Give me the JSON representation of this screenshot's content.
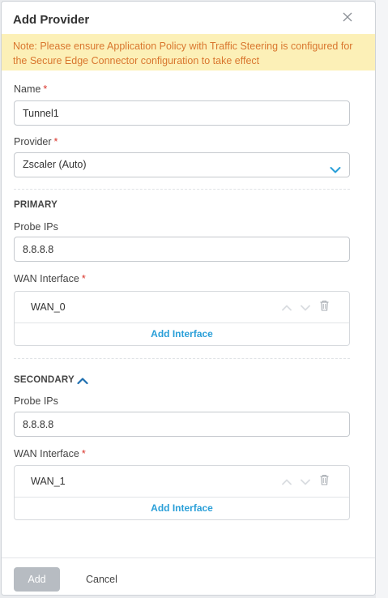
{
  "dialog": {
    "title": "Add Provider",
    "close_icon": "close-icon"
  },
  "note": {
    "text": "Note: Please ensure Application Policy with Traffic Steering is configured for the Secure Edge Connector configuration to take effect"
  },
  "form": {
    "name": {
      "label": "Name",
      "required_mark": "*",
      "value": "Tunnel1"
    },
    "provider": {
      "label": "Provider",
      "required_mark": "*",
      "selected": "Zscaler (Auto)",
      "icon": "chevron-down-icon"
    }
  },
  "primary": {
    "title": "PRIMARY",
    "probe_ips": {
      "label": "Probe IPs",
      "value": "8.8.8.8"
    },
    "wan_interface": {
      "label": "WAN Interface",
      "required_mark": "*",
      "items": [
        {
          "name": "WAN_0"
        }
      ],
      "add_label": "Add Interface"
    }
  },
  "secondary": {
    "title": "SECONDARY",
    "collapse_icon": "chevron-up-icon",
    "probe_ips": {
      "label": "Probe IPs",
      "value": "8.8.8.8"
    },
    "wan_interface": {
      "label": "WAN Interface",
      "required_mark": "*",
      "items": [
        {
          "name": "WAN_1"
        }
      ],
      "add_label": "Add Interface"
    }
  },
  "footer": {
    "add_label": "Add",
    "cancel_label": "Cancel"
  },
  "colors": {
    "accent": "#2a9fd8",
    "note_bg": "#fcf0b7",
    "note_text": "#d9762e",
    "required": "#d9342b",
    "disabled_button": "#b7bcc2"
  }
}
